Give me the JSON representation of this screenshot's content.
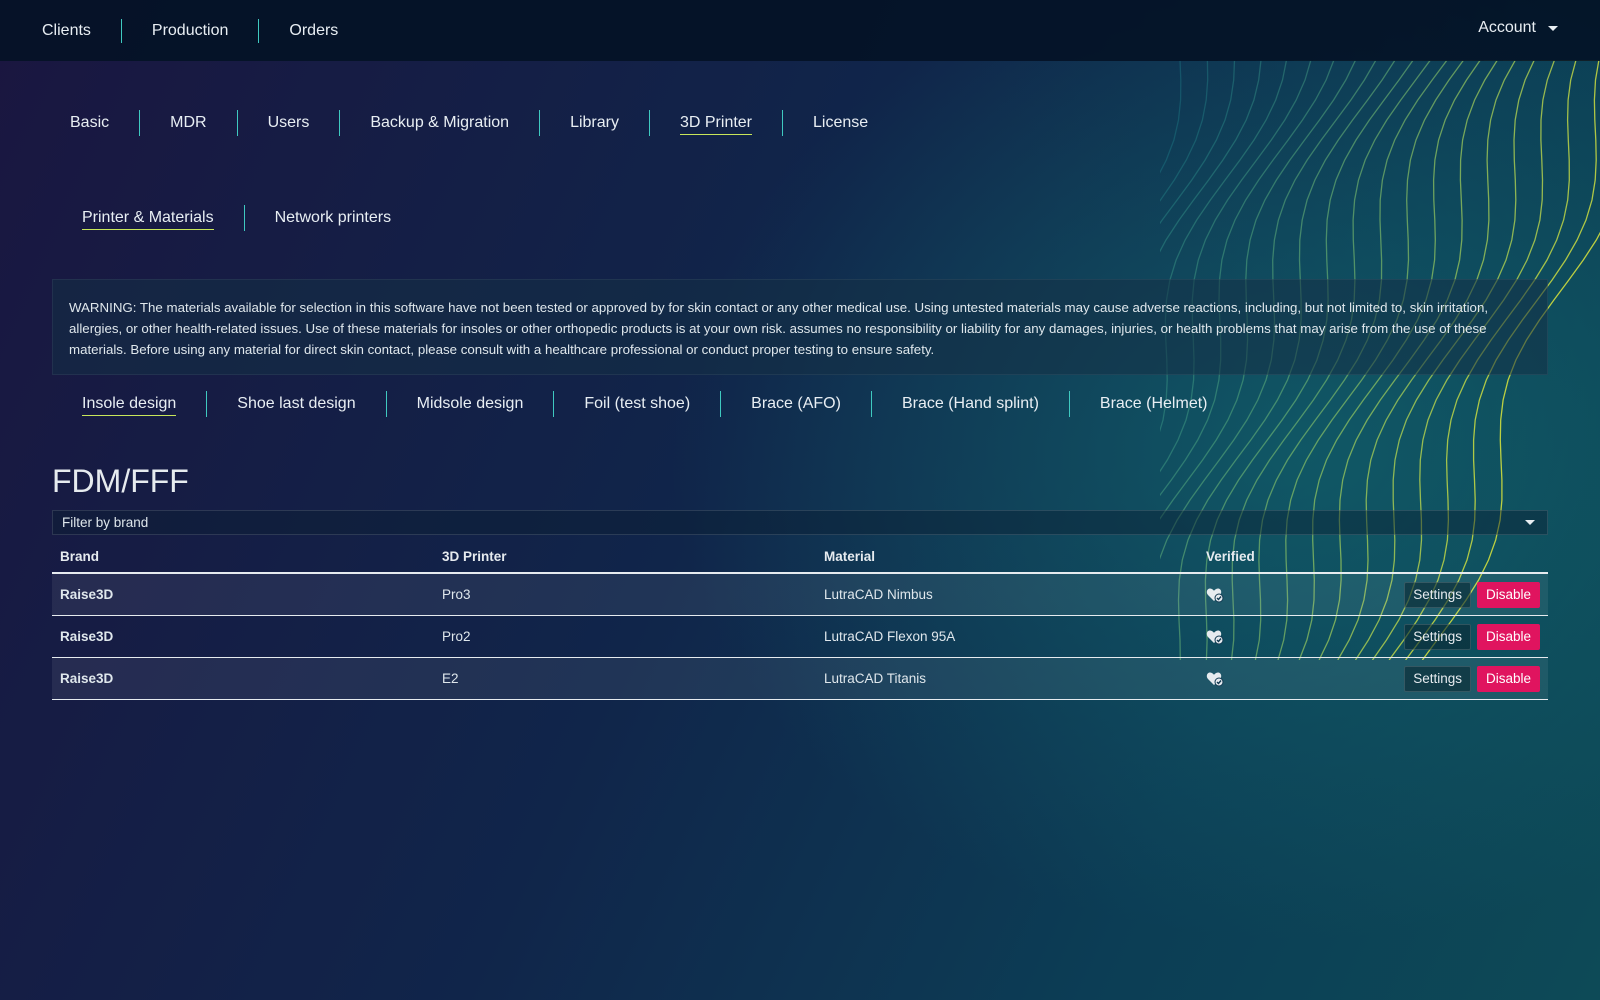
{
  "topnav": {
    "items": [
      "Clients",
      "Production",
      "Orders"
    ],
    "account_label": "Account"
  },
  "settings_tabs": [
    "Basic",
    "MDR",
    "Users",
    "Backup & Migration",
    "Library",
    "3D Printer",
    "License"
  ],
  "settings_active": "3D Printer",
  "sub_tabs": [
    "Printer & Materials",
    "Network printers"
  ],
  "sub_active": "Printer & Materials",
  "warning_text": "WARNING: The materials available for selection in this software have not been tested or approved by for skin contact or any other medical use. Using untested materials may cause adverse reactions, including, but not limited to, skin irritation, allergies, or other health-related issues. Use of these materials for insoles or other orthopedic products is at your own risk. assumes no responsibility or liability for any damages, injuries, or health problems that may arise from the use of these materials. Before using any material for direct skin contact, please consult with a healthcare professional or conduct proper testing to ensure safety.",
  "design_tabs": [
    "Insole design",
    "Shoe last design",
    "Midsole design",
    "Foil (test shoe)",
    "Brace (AFO)",
    "Brace (Hand splint)",
    "Brace (Helmet)"
  ],
  "design_active": "Insole design",
  "section_title": "FDM/FFF",
  "filter_placeholder": "Filter by brand",
  "table": {
    "headers": [
      "Brand",
      "3D Printer",
      "Material",
      "Verified"
    ],
    "rows": [
      {
        "brand": "Raise3D",
        "printer": "Pro3",
        "material": "LutraCAD Nimbus",
        "verified_icon": "verified-heart-icon",
        "settings_label": "Settings",
        "disable_label": "Disable"
      },
      {
        "brand": "Raise3D",
        "printer": "Pro2",
        "material": "LutraCAD Flexon 95A",
        "verified_icon": "verified-heart-icon",
        "settings_label": "Settings",
        "disable_label": "Disable"
      },
      {
        "brand": "Raise3D",
        "printer": "E2",
        "material": "LutraCAD Titanis",
        "verified_icon": "verified-heart-icon",
        "settings_label": "Settings",
        "disable_label": "Disable"
      }
    ]
  },
  "colors": {
    "accent_underline": "#c8e65a",
    "divider": "#3fc9c0",
    "danger": "#e0145f"
  }
}
